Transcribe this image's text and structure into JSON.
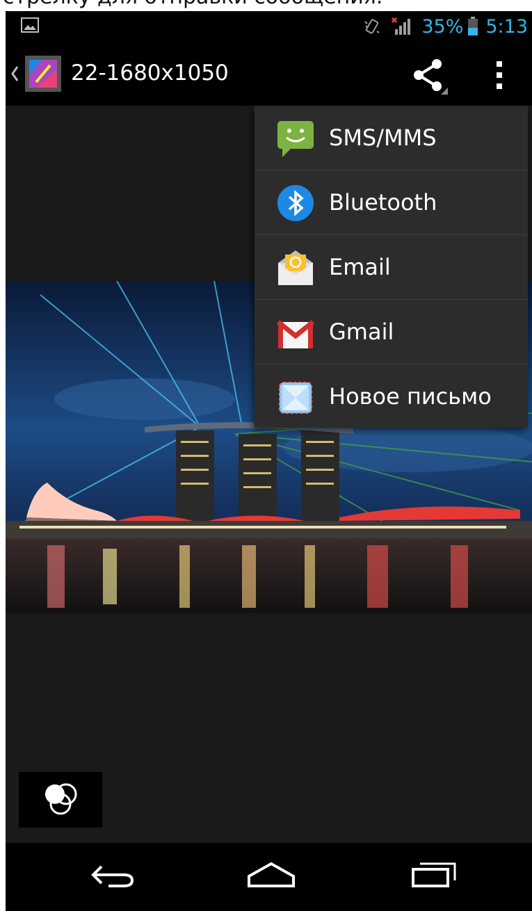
{
  "caption": {
    "text": "стрелку для отправки сообщения."
  },
  "status_bar": {
    "battery_percent": "35%",
    "time": "5:13",
    "accent_color": "#33b5e5"
  },
  "action_bar": {
    "title": "22-1680x1050",
    "up_icon": "chevron-left-icon",
    "app_icon": "gallery-icon",
    "share_icon": "share-icon",
    "overflow_icon": "overflow-menu-icon"
  },
  "share_menu": {
    "items": [
      {
        "label": "SMS/MMS",
        "icon": "sms-icon"
      },
      {
        "label": "Bluetooth",
        "icon": "bluetooth-icon"
      },
      {
        "label": "Email",
        "icon": "email-icon"
      },
      {
        "label": "Gmail",
        "icon": "gmail-icon"
      },
      {
        "label": "Новое письмо",
        "icon": "new-letter-icon"
      }
    ]
  },
  "photo": {
    "icon": "city-skyline-photo"
  },
  "bottom_controls": {
    "filter_icon": "photo-filter-icon"
  },
  "nav_bar": {
    "back_icon": "back-icon",
    "home_icon": "home-icon",
    "recents_icon": "recents-icon"
  }
}
